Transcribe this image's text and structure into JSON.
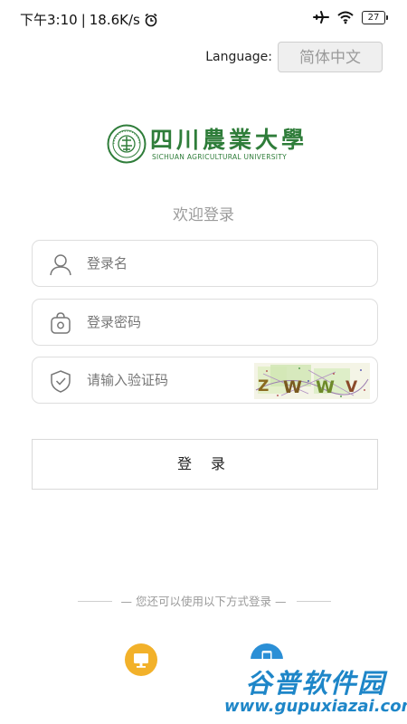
{
  "status_bar": {
    "time": "下午3:10",
    "network_speed": "18.6K/s",
    "battery": "27",
    "icons": [
      "alarm-icon",
      "airplane-icon",
      "wifi-icon",
      "battery-icon"
    ]
  },
  "language": {
    "label": "Language:",
    "selected": "简体中文"
  },
  "logo": {
    "name": "四川農業大學",
    "english": "SICHUAN AGRICULTURAL UNIVERSITY",
    "color": "#2f7d3a"
  },
  "welcome": "欢迎登录",
  "form": {
    "username_placeholder": "登录名",
    "password_placeholder": "登录密码",
    "captcha_placeholder": "请输入验证码",
    "captcha_code": "ZWWV"
  },
  "login_button": "登 录",
  "other_methods": "— 您还可以使用以下方式登录 —",
  "other_buttons": [
    {
      "icon": "monitor-icon",
      "color": "#f2b12a"
    },
    {
      "icon": "phone-icon",
      "color": "#2b8fd6"
    }
  ],
  "watermark": {
    "text": "谷普软件园",
    "url": "www.gupuxiazai.com"
  }
}
